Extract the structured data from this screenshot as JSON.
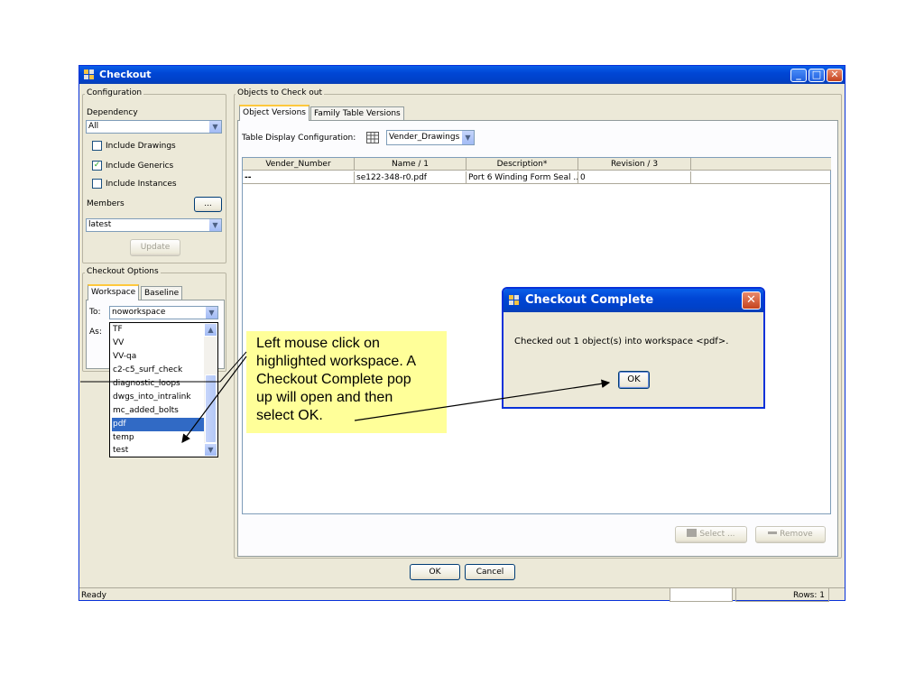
{
  "window": {
    "title": "Checkout",
    "colors": {
      "titlebar": "#0054e3",
      "face": "#ece9d8",
      "selection": "#316ac5",
      "note": "#ffff99"
    }
  },
  "configuration": {
    "group_label": "Configuration",
    "dependency_label": "Dependency",
    "dependency_value": "All",
    "include_drawings": {
      "label": "Include Drawings",
      "checked": false
    },
    "include_generics": {
      "label": "Include Generics",
      "checked": true
    },
    "include_instances": {
      "label": "Include Instances",
      "checked": false
    },
    "members_label": "Members",
    "members_button": "...",
    "members_value": "latest",
    "update_button": "Update"
  },
  "checkout_options": {
    "group_label": "Checkout Options",
    "tabs": [
      "Workspace",
      "Baseline"
    ],
    "to_label": "To:",
    "to_value": "noworkspace",
    "as_label": "As:",
    "list_items": [
      "TF",
      "VV",
      "VV-qa",
      "c2-c5_surf_check",
      "diagnostic_loops",
      "dwgs_into_intralink",
      "mc_added_bolts",
      "pdf",
      "temp",
      "test"
    ],
    "selected_item": "pdf"
  },
  "objects": {
    "group_label": "Objects to Check out",
    "tabs": [
      "Object Versions",
      "Family Table Versions"
    ],
    "table_config_label": "Table Display Configuration:",
    "table_config_value": "Vender_Drawings",
    "columns": [
      "Vender_Number",
      "Name  /  1",
      "Description*",
      "Revision  /  3",
      ""
    ],
    "rows": [
      [
        "--",
        "se122-348-r0.pdf",
        "Port 6 Winding Form Seal ...",
        "0",
        ""
      ]
    ],
    "select_button": "Select ...",
    "remove_button": "Remove"
  },
  "footer": {
    "ok_button": "OK",
    "cancel_button": "Cancel",
    "status_text": "Ready",
    "rows_text": "Rows: 1"
  },
  "popup": {
    "title": "Checkout Complete",
    "message": "Checked out 1 object(s) into workspace <pdf>.",
    "ok_button": "OK"
  },
  "note": {
    "lines": [
      "Left mouse click on",
      "highlighted workspace.  A",
      "Checkout Complete pop",
      "up will open and then",
      "select OK."
    ]
  }
}
